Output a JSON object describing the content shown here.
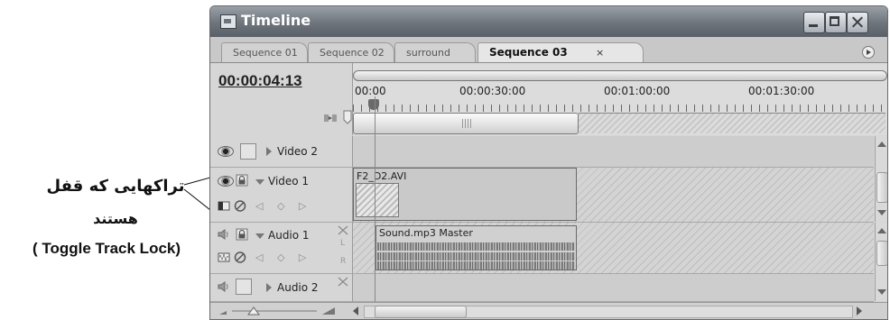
{
  "annotation": {
    "line1": "تراکهایی که قفل",
    "line2": "هستند",
    "line3": "( Toggle Track Lock)"
  },
  "window": {
    "title": "Timeline",
    "buttons": [
      "minimize",
      "maximize",
      "close"
    ]
  },
  "tabs": [
    {
      "label": "Sequence 01",
      "active": false
    },
    {
      "label": "Sequence 02",
      "active": false
    },
    {
      "label": "surround",
      "active": false
    },
    {
      "label": "Sequence 03",
      "active": true,
      "close": "×"
    }
  ],
  "timecode": "00:00:04:13",
  "ruler": {
    "labels": [
      "00:00",
      "00:00:30:00",
      "00:01:00:00",
      "00:01:30:00"
    ]
  },
  "tracks": {
    "video2": {
      "label": "Video 2"
    },
    "video1": {
      "label": "Video 1",
      "clip": "F2_D2.AVI",
      "keyframe_nav": "◁ ◇ ▷"
    },
    "audio1": {
      "label": "Audio 1",
      "clip": "Sound.mp3 Master",
      "keyframe_nav": "◁ ◇ ▷",
      "left": "L",
      "right": "R"
    },
    "audio2": {
      "label": "Audio 2"
    }
  },
  "icons": {
    "eye": "eye-icon",
    "lock": "lock-icon",
    "speaker": "speaker-icon",
    "snap": "snap-icon",
    "marker": "marker-icon"
  }
}
